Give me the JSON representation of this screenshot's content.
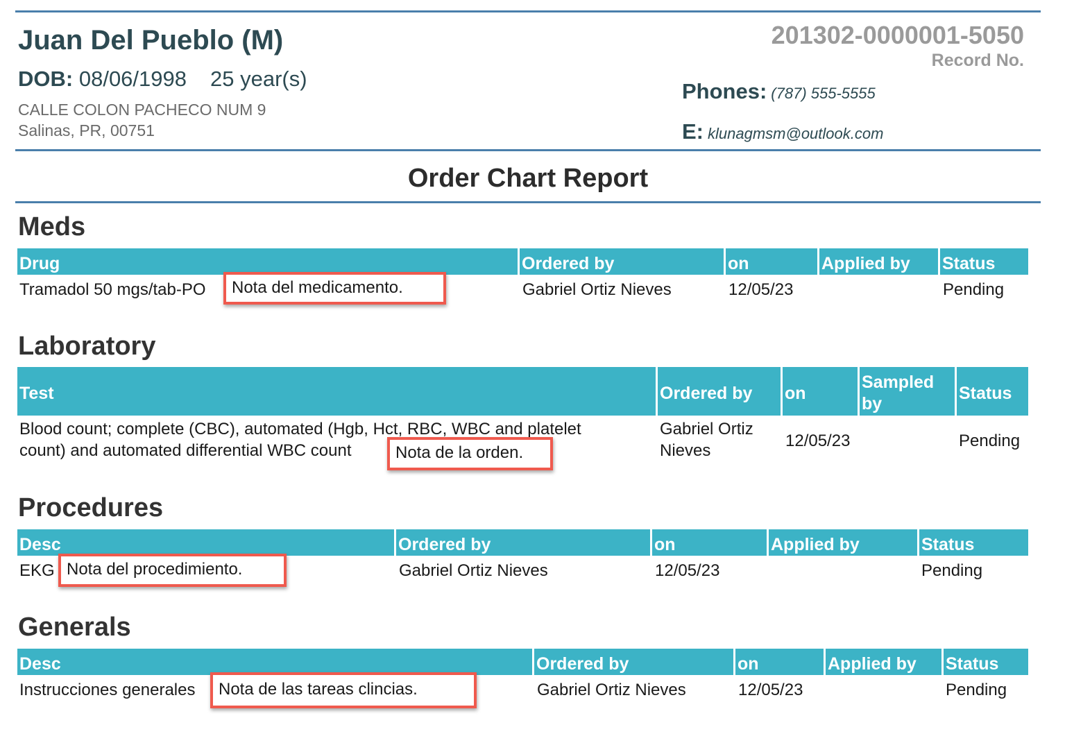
{
  "patient": {
    "name": "Juan Del Pueblo (M)",
    "dob_label": "DOB:",
    "dob": "08/06/1998",
    "age": "25 year(s)",
    "address_line1": "CALLE COLON PACHECO NUM 9",
    "address_line2": "Salinas, PR, 00751"
  },
  "record": {
    "number": "201302-0000001-5050",
    "label": "Record No."
  },
  "contact": {
    "phones_label": "Phones:",
    "phones": "(787) 555-5555",
    "email_label": "E:",
    "email": "klunagmsm@outlook.com"
  },
  "report_title": "Order Chart Report",
  "meds": {
    "title": "Meds",
    "headers": [
      "Drug",
      "Ordered by",
      "on",
      "Applied by",
      "Status"
    ],
    "row": {
      "drug": "Tramadol 50 mgs/tab-PO",
      "note": "Nota del medicamento.",
      "ordered_by": "Gabriel Ortiz Nieves",
      "on": "12/05/23",
      "applied_by": "",
      "status": "Pending"
    }
  },
  "laboratory": {
    "title": "Laboratory",
    "headers": [
      "Test",
      "Ordered by",
      "on",
      "Sampled by",
      "Status"
    ],
    "row": {
      "test_line1": "Blood count; complete (CBC), automated (Hgb, Hct, RBC, WBC and platelet",
      "test_line2": "count) and automated differential WBC count",
      "note": "Nota de la orden.",
      "ordered_by_line1": "Gabriel Ortiz",
      "ordered_by_line2": "Nieves",
      "on": "12/05/23",
      "sampled_by": "",
      "status": "Pending"
    }
  },
  "procedures": {
    "title": "Procedures",
    "headers": [
      "Desc",
      "Ordered by",
      "on",
      "Applied by",
      "Status"
    ],
    "row": {
      "desc": "EKG",
      "note": "Nota del procedimiento.",
      "ordered_by": "Gabriel Ortiz Nieves",
      "on": "12/05/23",
      "applied_by": "",
      "status": "Pending"
    }
  },
  "generals": {
    "title": "Generals",
    "headers": [
      "Desc",
      "Ordered by",
      "on",
      "Applied by",
      "Status"
    ],
    "row": {
      "desc": "Instrucciones generales",
      "note": "Nota de las tareas clincias.",
      "ordered_by": "Gabriel Ortiz Nieves",
      "on": "12/05/23",
      "applied_by": "",
      "status": "Pending"
    }
  },
  "colors": {
    "header_bg": "#3cb3c6",
    "rule": "#4a7fab",
    "highlight_border": "#ef5a4e"
  }
}
